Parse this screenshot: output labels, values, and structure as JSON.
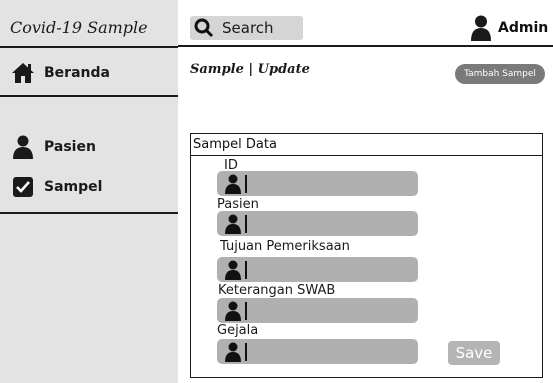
{
  "sidebar": {
    "brand": "Covid-19 Sample",
    "items": [
      {
        "label": "Beranda",
        "icon": "home-icon"
      },
      {
        "label": "Pasien",
        "icon": "user-icon"
      },
      {
        "label": "Sampel",
        "icon": "checkbox-icon"
      }
    ]
  },
  "topbar": {
    "search_label": "Search",
    "search_icon": "search-icon",
    "user_label": "Admin",
    "user_icon": "user-icon"
  },
  "main": {
    "title": "Sample | Update",
    "add_button": "Tambah Sampel",
    "panel": {
      "header": "Sampel Data",
      "fields": [
        {
          "label": "ID",
          "value": ""
        },
        {
          "label": "Pasien",
          "value": ""
        },
        {
          "label": "Tujuan Pemeriksaan",
          "value": ""
        },
        {
          "label": "Keterangan SWAB",
          "value": ""
        },
        {
          "label": "Gejala",
          "value": ""
        }
      ],
      "save_button": "Save"
    }
  },
  "colors": {
    "sidebar_bg": "#e3e3e3",
    "input_bg": "#b0b0b0",
    "button_bg": "#7a7a7a",
    "save_bg": "#b4b4b4"
  }
}
